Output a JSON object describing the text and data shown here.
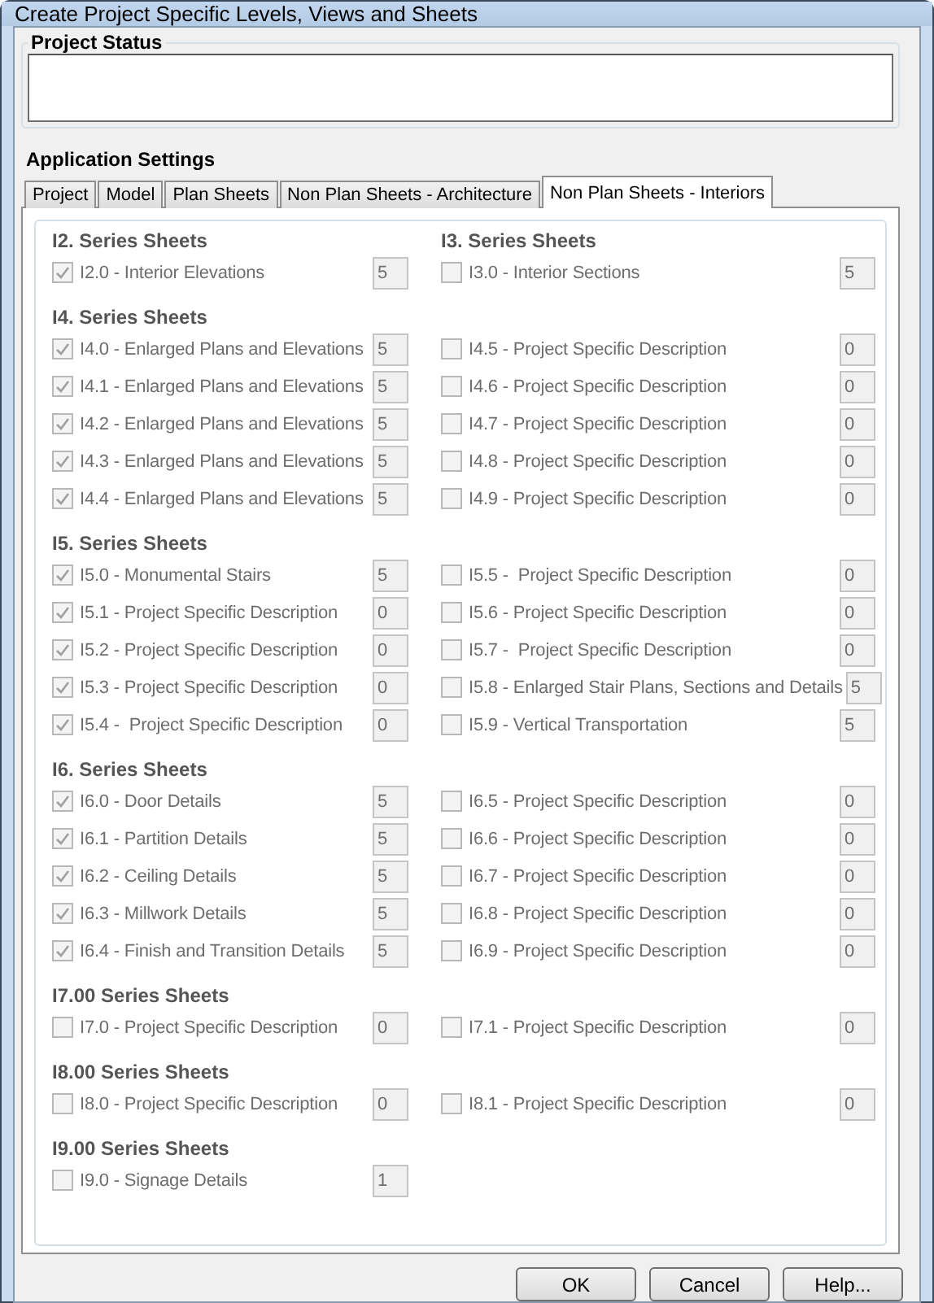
{
  "window": {
    "title": "Create Project Specific Levels, Views and Sheets"
  },
  "project_status": {
    "title": "Project Status"
  },
  "settings_title": "Application Settings",
  "tabs": [
    {
      "label": "Project",
      "selected": false
    },
    {
      "label": "Model",
      "selected": false
    },
    {
      "label": "Plan Sheets",
      "selected": false
    },
    {
      "label": "Non Plan Sheets - Architecture",
      "selected": false
    },
    {
      "label": "Non Plan Sheets - Interiors",
      "selected": true
    }
  ],
  "sheets": {
    "disabled": true,
    "sections": [
      {
        "headings": [
          "I2. Series Sheets",
          "I3. Series Sheets"
        ],
        "rows": [
          [
            {
              "label": "I2.0 - Interior Elevations",
              "checked": true,
              "count": "5"
            },
            {
              "label": "I3.0 - Interior Sections",
              "checked": false,
              "count": "5"
            }
          ]
        ]
      },
      {
        "headings": [
          "I4. Series Sheets"
        ],
        "rows": [
          [
            {
              "label": "I4.0 - Enlarged Plans and Elevations",
              "checked": true,
              "count": "5"
            },
            {
              "label": "I4.5 - Project Specific Description",
              "checked": false,
              "count": "0"
            }
          ],
          [
            {
              "label": "I4.1 - Enlarged Plans and Elevations",
              "checked": true,
              "count": "5"
            },
            {
              "label": "I4.6 - Project Specific Description",
              "checked": false,
              "count": "0"
            }
          ],
          [
            {
              "label": "I4.2 - Enlarged Plans and Elevations",
              "checked": true,
              "count": "5"
            },
            {
              "label": "I4.7 - Project Specific Description",
              "checked": false,
              "count": "0"
            }
          ],
          [
            {
              "label": "I4.3 - Enlarged Plans and Elevations",
              "checked": true,
              "count": "5"
            },
            {
              "label": "I4.8 - Project Specific Description",
              "checked": false,
              "count": "0"
            }
          ],
          [
            {
              "label": "I4.4 - Enlarged Plans and Elevations",
              "checked": true,
              "count": "5"
            },
            {
              "label": "I4.9 - Project Specific Description",
              "checked": false,
              "count": "0"
            }
          ]
        ]
      },
      {
        "headings": [
          "I5. Series Sheets"
        ],
        "rows": [
          [
            {
              "label": "I5.0 - Monumental Stairs",
              "checked": true,
              "count": "5"
            },
            {
              "label": "I5.5 -  Project Specific Description",
              "checked": false,
              "count": "0"
            }
          ],
          [
            {
              "label": "I5.1 - Project Specific Description",
              "checked": true,
              "count": "0"
            },
            {
              "label": "I5.6 - Project Specific Description",
              "checked": false,
              "count": "0"
            }
          ],
          [
            {
              "label": "I5.2 - Project Specific Description",
              "checked": true,
              "count": "0"
            },
            {
              "label": "I5.7 -  Project Specific Description",
              "checked": false,
              "count": "0"
            }
          ],
          [
            {
              "label": "I5.3 - Project Specific Description",
              "checked": true,
              "count": "0"
            },
            {
              "label": "I5.8 - Enlarged Stair Plans, Sections and Details",
              "checked": false,
              "count": "5"
            }
          ],
          [
            {
              "label": "I5.4 -  Project Specific Description",
              "checked": true,
              "count": "0"
            },
            {
              "label": "I5.9 - Vertical Transportation",
              "checked": false,
              "count": "5"
            }
          ]
        ]
      },
      {
        "headings": [
          "I6. Series Sheets"
        ],
        "rows": [
          [
            {
              "label": "I6.0 - Door Details",
              "checked": true,
              "count": "5"
            },
            {
              "label": "I6.5 - Project Specific Description",
              "checked": false,
              "count": "0"
            }
          ],
          [
            {
              "label": "I6.1 - Partition Details",
              "checked": true,
              "count": "5"
            },
            {
              "label": "I6.6 - Project Specific Description",
              "checked": false,
              "count": "0"
            }
          ],
          [
            {
              "label": "I6.2 - Ceiling Details",
              "checked": true,
              "count": "5"
            },
            {
              "label": "I6.7 - Project Specific Description",
              "checked": false,
              "count": "0"
            }
          ],
          [
            {
              "label": "I6.3 - Millwork Details",
              "checked": true,
              "count": "5"
            },
            {
              "label": "I6.8 - Project Specific Description",
              "checked": false,
              "count": "0"
            }
          ],
          [
            {
              "label": "I6.4 - Finish and Transition Details",
              "checked": true,
              "count": "5"
            },
            {
              "label": "I6.9 - Project Specific Description",
              "checked": false,
              "count": "0"
            }
          ]
        ]
      },
      {
        "headings": [
          "I7.00 Series Sheets"
        ],
        "rows": [
          [
            {
              "label": "I7.0 - Project Specific Description",
              "checked": false,
              "count": "0"
            },
            {
              "label": "I7.1 - Project Specific Description",
              "checked": false,
              "count": "0"
            }
          ]
        ]
      },
      {
        "headings": [
          "I8.00 Series Sheets"
        ],
        "rows": [
          [
            {
              "label": "I8.0 - Project Specific Description",
              "checked": false,
              "count": "0"
            },
            {
              "label": "I8.1 - Project Specific Description",
              "checked": false,
              "count": "0"
            }
          ]
        ]
      },
      {
        "headings": [
          "I9.00 Series Sheets"
        ],
        "rows": [
          [
            {
              "label": "I9.0 - Signage Details",
              "checked": false,
              "count": "1"
            }
          ]
        ]
      }
    ]
  },
  "buttons": [
    "OK",
    "Cancel",
    "Help..."
  ]
}
